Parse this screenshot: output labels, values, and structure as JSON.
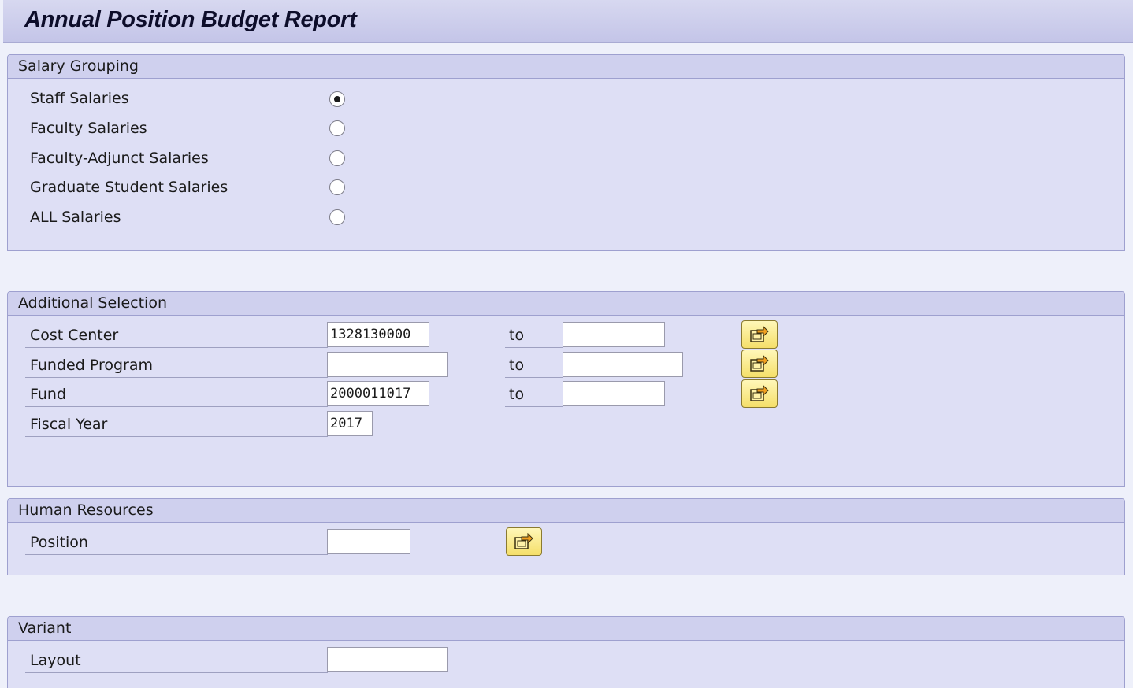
{
  "window": {
    "title": "Annual Position Budget Report"
  },
  "salary_grouping": {
    "header": "Salary Grouping",
    "options": [
      {
        "label": "Staff Salaries",
        "selected": true
      },
      {
        "label": "Faculty Salaries",
        "selected": false
      },
      {
        "label": "Faculty-Adjunct Salaries",
        "selected": false
      },
      {
        "label": "Graduate Student Salaries",
        "selected": false
      },
      {
        "label": "ALL Salaries",
        "selected": false
      }
    ]
  },
  "additional_selection": {
    "header": "Additional Selection",
    "to_label": "to",
    "fields": [
      {
        "label": "Cost Center",
        "from": "1328130000",
        "to": ""
      },
      {
        "label": "Funded Program",
        "from": "",
        "to": ""
      },
      {
        "label": "Fund",
        "from": "2000011017",
        "to": ""
      },
      {
        "label": "Fiscal Year",
        "value": "2017"
      }
    ]
  },
  "human_resources": {
    "header": "Human Resources",
    "fields": [
      {
        "label": "Position",
        "value": ""
      }
    ]
  },
  "variant": {
    "header": "Variant",
    "fields": [
      {
        "label": "Layout",
        "value": ""
      }
    ]
  },
  "icons": {
    "multiple_selection": "multiple-selection-arrow-icon"
  },
  "colors": {
    "header_bg": "#cfd0ee",
    "group_bg": "#dedff5",
    "button_yellow": "#f5df6a"
  }
}
